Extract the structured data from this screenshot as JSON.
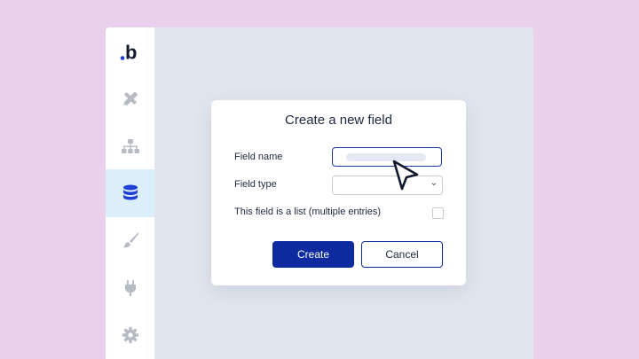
{
  "sidebar": {
    "logo": "b",
    "items": [
      {
        "name": "design",
        "icon": "pencil-ruler-icon",
        "active": false
      },
      {
        "name": "workflow",
        "icon": "sitemap-icon",
        "active": false
      },
      {
        "name": "data",
        "icon": "database-icon",
        "active": true
      },
      {
        "name": "styles",
        "icon": "paintbrush-icon",
        "active": false
      },
      {
        "name": "plugins",
        "icon": "plug-icon",
        "active": false
      },
      {
        "name": "settings",
        "icon": "gear-icon",
        "active": false
      }
    ]
  },
  "dialog": {
    "title": "Create a new field",
    "field_name_label": "Field name",
    "field_type_label": "Field type",
    "list_label": "This field is a list (multiple entries)",
    "create_label": "Create",
    "cancel_label": "Cancel"
  },
  "colors": {
    "background": "#e9d1ec",
    "accent": "#0d2b9e",
    "active_nav": "#dbeefa",
    "active_icon": "#1d3fd6"
  }
}
